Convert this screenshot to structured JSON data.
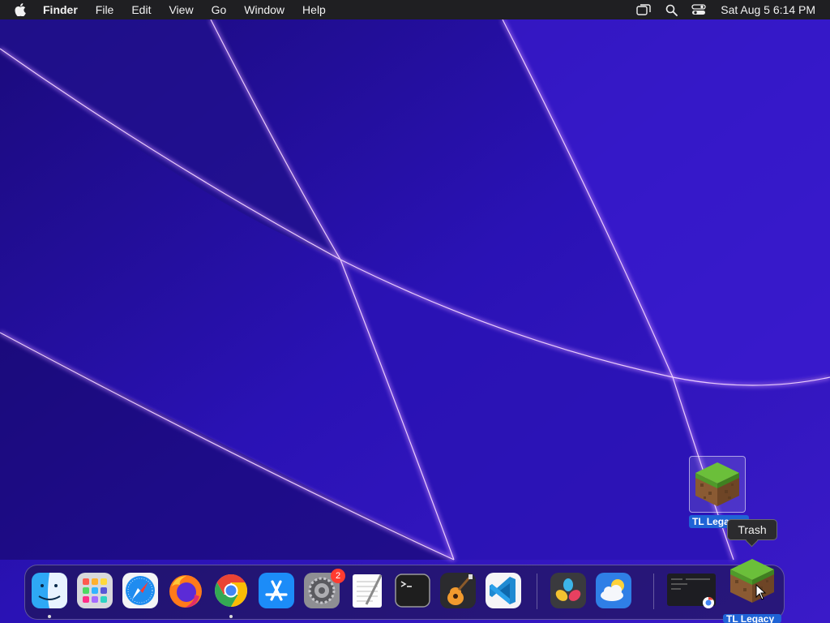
{
  "menubar": {
    "app_name": "Finder",
    "menus": [
      "File",
      "Edit",
      "View",
      "Go",
      "Window",
      "Help"
    ],
    "clock": "Sat Aug 5  6:14 PM",
    "status_icons": [
      "screen-mirroring-icon",
      "spotlight-search-icon",
      "control-center-icon"
    ]
  },
  "desktop": {
    "icon_label": "TL Legacy"
  },
  "tooltip": {
    "text": "Trash"
  },
  "dock": {
    "apps": [
      {
        "name": "finder",
        "running": true
      },
      {
        "name": "launchpad",
        "running": false
      },
      {
        "name": "safari",
        "running": false
      },
      {
        "name": "firefox",
        "running": false
      },
      {
        "name": "chrome",
        "running": true
      },
      {
        "name": "app-store",
        "running": false
      },
      {
        "name": "system-settings",
        "running": false,
        "badge": "2"
      },
      {
        "name": "textedit",
        "running": false
      },
      {
        "name": "terminal",
        "running": false
      },
      {
        "name": "garageband",
        "running": false
      },
      {
        "name": "vscode",
        "running": false
      },
      {
        "name": "davinci-resolve",
        "running": false
      },
      {
        "name": "weather",
        "running": false
      }
    ],
    "trash_label": "TL Legacy"
  },
  "colors": {
    "menubar_bg": "#1f1f22",
    "selection_blue": "#1f63d6",
    "badge_red": "#ff3b30"
  }
}
